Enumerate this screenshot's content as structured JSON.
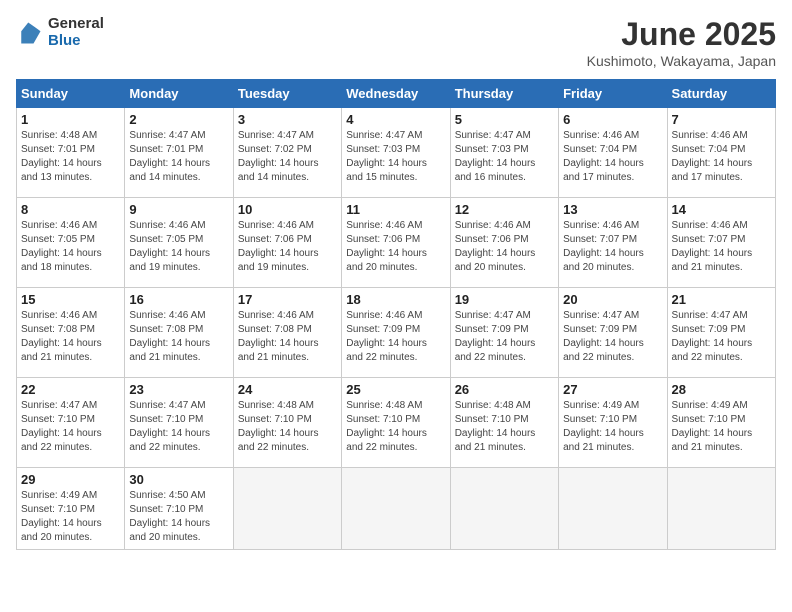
{
  "logo": {
    "general": "General",
    "blue": "Blue"
  },
  "title": "June 2025",
  "location": "Kushimoto, Wakayama, Japan",
  "headers": [
    "Sunday",
    "Monday",
    "Tuesday",
    "Wednesday",
    "Thursday",
    "Friday",
    "Saturday"
  ],
  "weeks": [
    [
      {
        "day": "1",
        "sunrise": "4:48 AM",
        "sunset": "7:01 PM",
        "daylight": "14 hours and 13 minutes."
      },
      {
        "day": "2",
        "sunrise": "4:47 AM",
        "sunset": "7:01 PM",
        "daylight": "14 hours and 14 minutes."
      },
      {
        "day": "3",
        "sunrise": "4:47 AM",
        "sunset": "7:02 PM",
        "daylight": "14 hours and 14 minutes."
      },
      {
        "day": "4",
        "sunrise": "4:47 AM",
        "sunset": "7:03 PM",
        "daylight": "14 hours and 15 minutes."
      },
      {
        "day": "5",
        "sunrise": "4:47 AM",
        "sunset": "7:03 PM",
        "daylight": "14 hours and 16 minutes."
      },
      {
        "day": "6",
        "sunrise": "4:46 AM",
        "sunset": "7:04 PM",
        "daylight": "14 hours and 17 minutes."
      },
      {
        "day": "7",
        "sunrise": "4:46 AM",
        "sunset": "7:04 PM",
        "daylight": "14 hours and 17 minutes."
      }
    ],
    [
      {
        "day": "8",
        "sunrise": "4:46 AM",
        "sunset": "7:05 PM",
        "daylight": "14 hours and 18 minutes."
      },
      {
        "day": "9",
        "sunrise": "4:46 AM",
        "sunset": "7:05 PM",
        "daylight": "14 hours and 19 minutes."
      },
      {
        "day": "10",
        "sunrise": "4:46 AM",
        "sunset": "7:06 PM",
        "daylight": "14 hours and 19 minutes."
      },
      {
        "day": "11",
        "sunrise": "4:46 AM",
        "sunset": "7:06 PM",
        "daylight": "14 hours and 20 minutes."
      },
      {
        "day": "12",
        "sunrise": "4:46 AM",
        "sunset": "7:06 PM",
        "daylight": "14 hours and 20 minutes."
      },
      {
        "day": "13",
        "sunrise": "4:46 AM",
        "sunset": "7:07 PM",
        "daylight": "14 hours and 20 minutes."
      },
      {
        "day": "14",
        "sunrise": "4:46 AM",
        "sunset": "7:07 PM",
        "daylight": "14 hours and 21 minutes."
      }
    ],
    [
      {
        "day": "15",
        "sunrise": "4:46 AM",
        "sunset": "7:08 PM",
        "daylight": "14 hours and 21 minutes."
      },
      {
        "day": "16",
        "sunrise": "4:46 AM",
        "sunset": "7:08 PM",
        "daylight": "14 hours and 21 minutes."
      },
      {
        "day": "17",
        "sunrise": "4:46 AM",
        "sunset": "7:08 PM",
        "daylight": "14 hours and 21 minutes."
      },
      {
        "day": "18",
        "sunrise": "4:46 AM",
        "sunset": "7:09 PM",
        "daylight": "14 hours and 22 minutes."
      },
      {
        "day": "19",
        "sunrise": "4:47 AM",
        "sunset": "7:09 PM",
        "daylight": "14 hours and 22 minutes."
      },
      {
        "day": "20",
        "sunrise": "4:47 AM",
        "sunset": "7:09 PM",
        "daylight": "14 hours and 22 minutes."
      },
      {
        "day": "21",
        "sunrise": "4:47 AM",
        "sunset": "7:09 PM",
        "daylight": "14 hours and 22 minutes."
      }
    ],
    [
      {
        "day": "22",
        "sunrise": "4:47 AM",
        "sunset": "7:10 PM",
        "daylight": "14 hours and 22 minutes."
      },
      {
        "day": "23",
        "sunrise": "4:47 AM",
        "sunset": "7:10 PM",
        "daylight": "14 hours and 22 minutes."
      },
      {
        "day": "24",
        "sunrise": "4:48 AM",
        "sunset": "7:10 PM",
        "daylight": "14 hours and 22 minutes."
      },
      {
        "day": "25",
        "sunrise": "4:48 AM",
        "sunset": "7:10 PM",
        "daylight": "14 hours and 22 minutes."
      },
      {
        "day": "26",
        "sunrise": "4:48 AM",
        "sunset": "7:10 PM",
        "daylight": "14 hours and 21 minutes."
      },
      {
        "day": "27",
        "sunrise": "4:49 AM",
        "sunset": "7:10 PM",
        "daylight": "14 hours and 21 minutes."
      },
      {
        "day": "28",
        "sunrise": "4:49 AM",
        "sunset": "7:10 PM",
        "daylight": "14 hours and 21 minutes."
      }
    ],
    [
      {
        "day": "29",
        "sunrise": "4:49 AM",
        "sunset": "7:10 PM",
        "daylight": "14 hours and 20 minutes."
      },
      {
        "day": "30",
        "sunrise": "4:50 AM",
        "sunset": "7:10 PM",
        "daylight": "14 hours and 20 minutes."
      },
      null,
      null,
      null,
      null,
      null
    ]
  ]
}
